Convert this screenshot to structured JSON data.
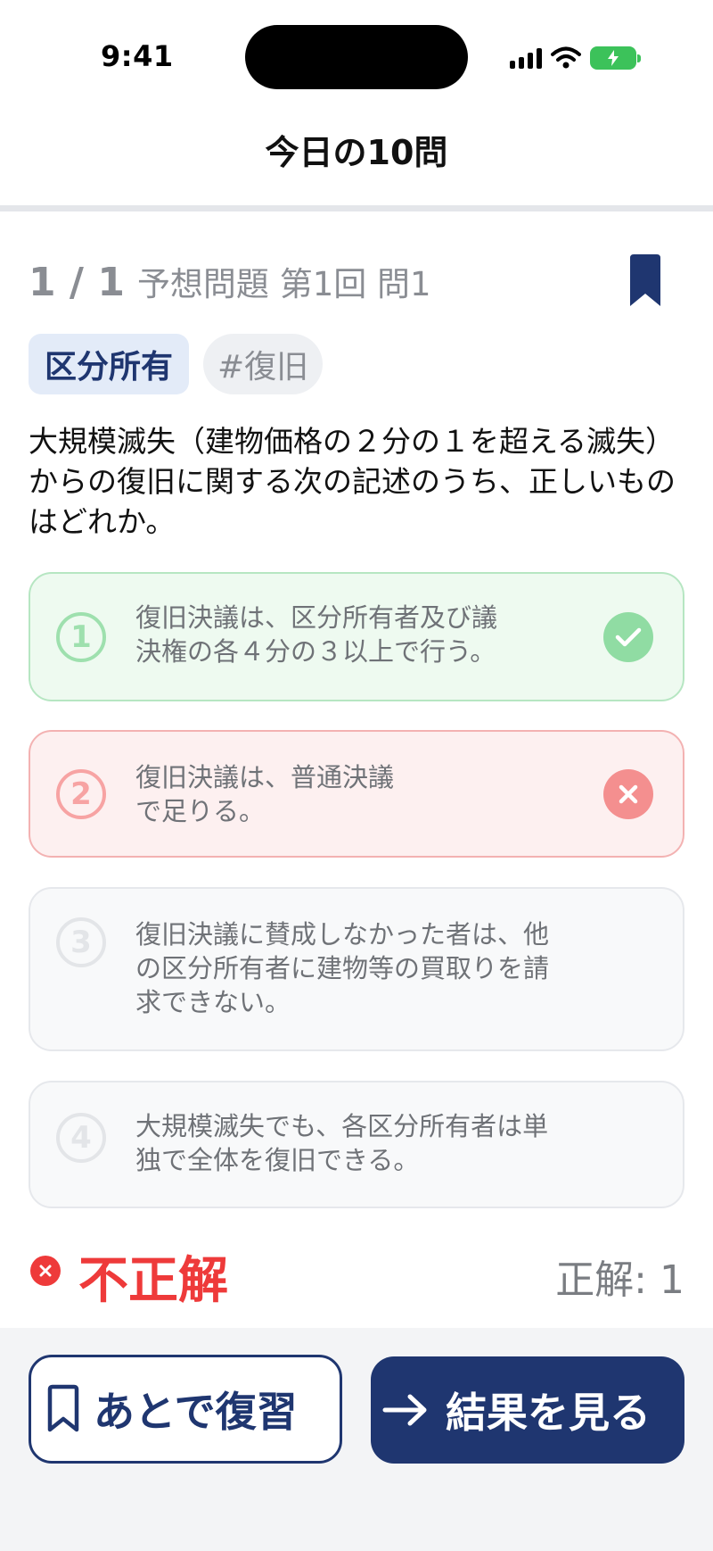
{
  "status_bar": {
    "time": "9:41"
  },
  "nav": {
    "title": "今日の10問"
  },
  "question": {
    "index": "1 / 1",
    "source": "予想問題 第1回 問1",
    "tags": {
      "primary": "区分所有",
      "secondary": "#復旧"
    },
    "text": "大規模滅失（建物価格の２分の１を超える滅失）からの復旧に関する次の記述のうち、正しいものはどれか。"
  },
  "options": [
    {
      "num": "1",
      "line1": "復旧決議は、区分所有者及び議",
      "line2": "決権の各４分の３以上で行う。",
      "line3": "",
      "state": "correct"
    },
    {
      "num": "2",
      "line1": "復旧決議は、普通決議",
      "line2": "で足りる。",
      "line3": "",
      "state": "wrong"
    },
    {
      "num": "3",
      "line1": "復旧決議に賛成しなかった者は、他",
      "line2": "の区分所有者に建物等の買取りを請",
      "line3": "求できない。",
      "state": "neutral"
    },
    {
      "num": "4",
      "line1": "大規模滅失でも、各区分所有者は単",
      "line2": "独で全体を復旧できる。",
      "line3": "",
      "state": "neutral"
    }
  ],
  "result": {
    "label": "不正解",
    "answer": "正解: 1"
  },
  "actions": {
    "review_label": "あとで復習",
    "results_label": "結果を見る"
  },
  "colors": {
    "brand": "#1f3670",
    "correct": "#90dca3",
    "wrong": "#ee3a3a"
  }
}
